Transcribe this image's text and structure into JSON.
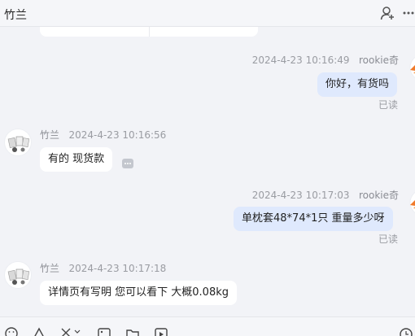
{
  "header": {
    "title": "竹兰"
  },
  "messages": [
    {
      "direction": "out",
      "sender": "rookie奇",
      "time": "2024-4-23 10:16:49",
      "text": "你好，有货吗",
      "status": "已读"
    },
    {
      "direction": "in",
      "sender": "竹兰",
      "time": "2024-4-23 10:16:56",
      "text": "有的 现货款"
    },
    {
      "direction": "out",
      "sender": "rookie奇",
      "time": "2024-4-23 10:17:03",
      "text": "单枕套48*74*1只   重量多少呀",
      "status": "已读"
    },
    {
      "direction": "in",
      "sender": "竹兰",
      "time": "2024-4-23 10:17:18",
      "text": "详情页有写明  您可以看下 大概0.08kg"
    }
  ],
  "colors": {
    "background": "#f2f3f7",
    "incoming_bubble": "#ffffff",
    "outgoing_bubble": "#dfe9fd",
    "accent_orange": "#f07a2a"
  },
  "icons": {
    "header": [
      "add-contact-icon",
      "more-icon"
    ],
    "toolbar": [
      "emoji-icon",
      "send-file-icon",
      "scissors-icon",
      "image-icon",
      "folder-icon",
      "video-icon",
      "history-icon"
    ]
  }
}
